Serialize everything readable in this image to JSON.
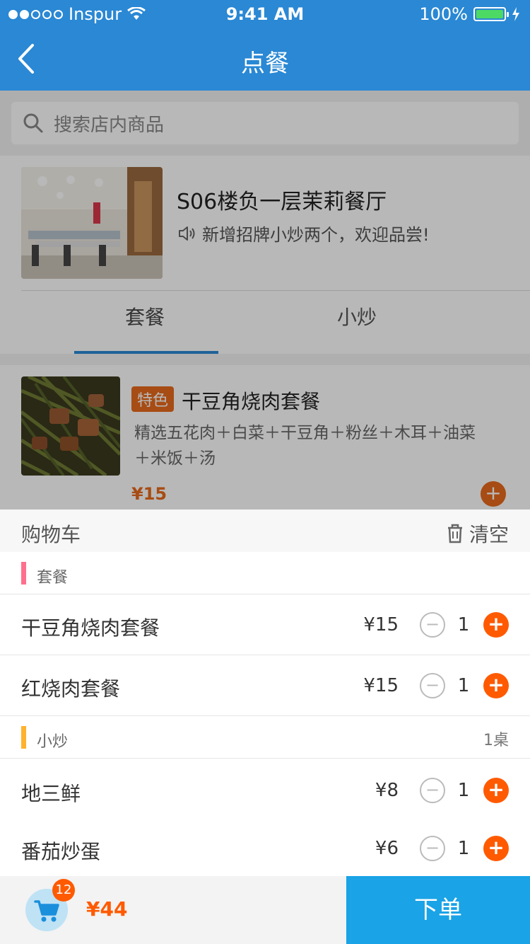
{
  "status_bar": {
    "carrier": "Inspur",
    "time": "9:41 AM",
    "battery": "100%"
  },
  "nav": {
    "title": "点餐"
  },
  "search": {
    "placeholder": "搜索店内商品"
  },
  "shop": {
    "name": "S06楼负一层茉莉餐厅",
    "notice": "新增招牌小炒两个，欢迎品尝!"
  },
  "tabs": [
    {
      "label": "套餐"
    },
    {
      "label": "小炒"
    }
  ],
  "dish": {
    "tag": "特色",
    "name": "干豆角烧肉套餐",
    "desc": "精选五花肉＋白菜＋干豆角＋粉丝＋木耳＋油菜＋米饭＋汤",
    "price": "¥15"
  },
  "cart": {
    "title": "购物车",
    "clear_label": "清空",
    "groups": [
      {
        "label": "套餐",
        "extra": "",
        "items": [
          {
            "name": "干豆角烧肉套餐",
            "price": "¥15",
            "qty": "1"
          },
          {
            "name": "红烧肉套餐",
            "price": "¥15",
            "qty": "1"
          }
        ]
      },
      {
        "label": "小炒",
        "extra": "1桌",
        "items": [
          {
            "name": "地三鲜",
            "price": "¥8",
            "qty": "1"
          },
          {
            "name": "番茄炒蛋",
            "price": "¥6",
            "qty": "1"
          }
        ]
      }
    ]
  },
  "bottom": {
    "count": "12",
    "total": "¥44",
    "order_label": "下单"
  },
  "colors": {
    "primary": "#2a88d4",
    "accent": "#ff5a00",
    "order_button": "#1aa3e6",
    "group_bar_1": "#ff6f8e",
    "group_bar_2": "#ffb22c"
  },
  "icons": {
    "back": "chevron-left-icon",
    "search": "search-icon",
    "speaker": "speaker-icon",
    "trash": "trash-icon",
    "cart": "cart-icon",
    "wifi": "wifi-icon",
    "battery": "battery-icon",
    "plus": "plus-icon",
    "minus": "minus-icon"
  }
}
